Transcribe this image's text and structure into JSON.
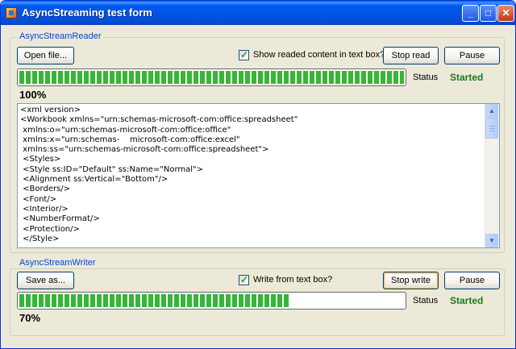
{
  "window": {
    "title": "AsyncStreaming test form",
    "buttons": {
      "minimize": "minimize-icon",
      "maximize": "maximize-icon",
      "close": "close-icon"
    },
    "app_icon": "form-app-icon"
  },
  "reader": {
    "group_label": "AsyncStreamReader",
    "open_button": "Open file...",
    "show_checkbox_label": "Show readed content in text box?",
    "show_checked": true,
    "stop_button": "Stop read",
    "pause_button": "Pause",
    "progress": 1.0,
    "percent_text": "100%",
    "status_label": "Status",
    "status_value": "Started",
    "content": "<xml version>\n<Workbook xmlns=\"urn:schemas-microsoft-com:office:spreadsheet\"\n xmlns:o=\"urn:schemas-microsoft-com:office:office\"\n xmlns:x=\"urn:schemas-    microsoft-com:office:excel\"\n xmlns:ss=\"urn:schemas-microsoft-com:office:spreadsheet\">\n <Styles>\n <Style ss:ID=\"Default\" ss:Name=\"Normal\">\n <Alignment ss:Vertical=\"Bottom\"/>\n <Borders/>\n <Font/>\n <Interior/>\n <NumberFormat/>\n <Protection/>\n </Style>"
  },
  "writer": {
    "group_label": "AsyncStreamWriter",
    "save_button": "Save as...",
    "write_checkbox_label": "Write from text box?",
    "write_checked": true,
    "stop_button": "Stop write",
    "pause_button": "Pause",
    "progress": 0.7,
    "percent_text": "70%",
    "status_label": "Status",
    "status_value": "Started"
  },
  "colors": {
    "status_started": "#1e7a1e",
    "progress_fill": "#36b536",
    "group_label": "#0046d5",
    "titlebar": "#0054e3"
  }
}
